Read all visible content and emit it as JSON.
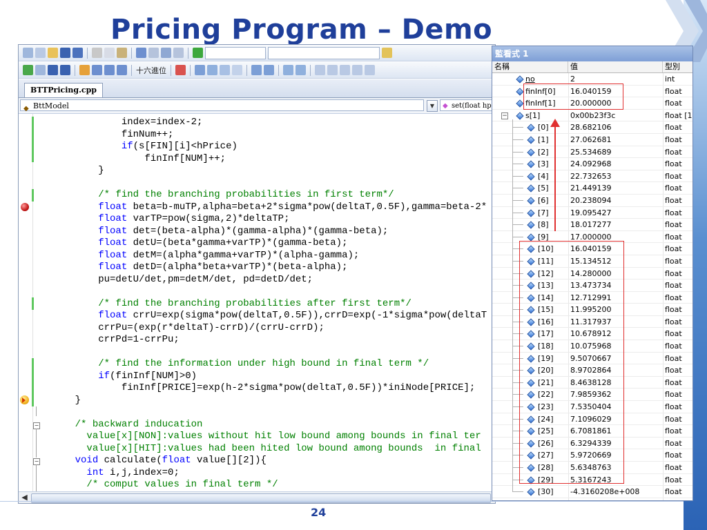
{
  "slide": {
    "title": "Pricing Program – Demo",
    "page_number": "24"
  },
  "ide": {
    "toolbar2_hex_label": "十六進位",
    "file_tab": "BTTPricing.cpp",
    "class_dropdown": "BttModel",
    "member_dropdown": "set(float hp",
    "code_lines": [
      {
        "indent": 12,
        "segments": [
          {
            "t": "index=index-2;",
            "c": ""
          }
        ]
      },
      {
        "indent": 12,
        "segments": [
          {
            "t": "finNum++;",
            "c": ""
          }
        ]
      },
      {
        "indent": 12,
        "segments": [
          {
            "t": "if",
            "c": "kw"
          },
          {
            "t": "(s[FIN][i]<hPrice)",
            "c": ""
          }
        ]
      },
      {
        "indent": 16,
        "segments": [
          {
            "t": "finInf[NUM]++;",
            "c": ""
          }
        ]
      },
      {
        "indent": 8,
        "segments": [
          {
            "t": "}",
            "c": ""
          }
        ]
      },
      {
        "indent": 0,
        "segments": []
      },
      {
        "indent": 8,
        "segments": [
          {
            "t": "/* find the branching probabilities in first term*/",
            "c": "cm"
          }
        ]
      },
      {
        "indent": 8,
        "segments": [
          {
            "t": "float",
            "c": "kw"
          },
          {
            "t": " beta=b-muTP,alpha=beta+2*sigma*pow(deltaT,0.5F),gamma=beta-2*",
            "c": ""
          }
        ]
      },
      {
        "indent": 8,
        "segments": [
          {
            "t": "float",
            "c": "kw"
          },
          {
            "t": " varTP=pow(sigma,2)*deltaTP;",
            "c": ""
          }
        ]
      },
      {
        "indent": 8,
        "segments": [
          {
            "t": "float",
            "c": "kw"
          },
          {
            "t": " det=(beta-alpha)*(gamma-alpha)*(gamma-beta);",
            "c": ""
          }
        ]
      },
      {
        "indent": 8,
        "segments": [
          {
            "t": "float",
            "c": "kw"
          },
          {
            "t": " detU=(beta*gamma+varTP)*(gamma-beta);",
            "c": ""
          }
        ]
      },
      {
        "indent": 8,
        "segments": [
          {
            "t": "float",
            "c": "kw"
          },
          {
            "t": " detM=(alpha*gamma+varTP)*(alpha-gamma);",
            "c": ""
          }
        ]
      },
      {
        "indent": 8,
        "segments": [
          {
            "t": "float",
            "c": "kw"
          },
          {
            "t": " detD=(alpha*beta+varTP)*(beta-alpha);",
            "c": ""
          }
        ]
      },
      {
        "indent": 8,
        "segments": [
          {
            "t": "pu=detU/det,pm=detM/det, pd=detD/det;",
            "c": ""
          }
        ]
      },
      {
        "indent": 0,
        "segments": []
      },
      {
        "indent": 8,
        "segments": [
          {
            "t": "/* find the branching probabilities after first term*/",
            "c": "cm"
          }
        ]
      },
      {
        "indent": 8,
        "segments": [
          {
            "t": "float",
            "c": "kw"
          },
          {
            "t": " crrU=exp(sigma*pow(deltaT,0.5F)),crrD=exp(-1*sigma*pow(deltaT",
            "c": ""
          }
        ]
      },
      {
        "indent": 8,
        "segments": [
          {
            "t": "crrPu=(exp(r*deltaT)-crrD)/(crrU-crrD);",
            "c": ""
          }
        ]
      },
      {
        "indent": 8,
        "segments": [
          {
            "t": "crrPd=1-crrPu;",
            "c": ""
          }
        ]
      },
      {
        "indent": 0,
        "segments": []
      },
      {
        "indent": 8,
        "segments": [
          {
            "t": "/* find the information under high bound in final term */",
            "c": "cm"
          }
        ]
      },
      {
        "indent": 8,
        "segments": [
          {
            "t": "if",
            "c": "kw"
          },
          {
            "t": "(finInf[NUM]>0)",
            "c": ""
          }
        ]
      },
      {
        "indent": 12,
        "segments": [
          {
            "t": "finInf[PRICE]=exp(h-2*sigma*pow(deltaT,0.5F))*iniNode[PRICE];",
            "c": ""
          }
        ]
      },
      {
        "indent": 4,
        "segments": [
          {
            "t": "}",
            "c": ""
          }
        ]
      },
      {
        "indent": 0,
        "segments": []
      },
      {
        "indent": 4,
        "segments": [
          {
            "t": "/* backward inducation",
            "c": "cm"
          }
        ]
      },
      {
        "indent": 6,
        "segments": [
          {
            "t": "value[x][NON]:values without hit low bound among bounds in final ter",
            "c": "cm"
          }
        ]
      },
      {
        "indent": 6,
        "segments": [
          {
            "t": "value[x][HIT]:values had been hited low bound among bounds  in final",
            "c": "cm"
          }
        ]
      },
      {
        "indent": 4,
        "segments": [
          {
            "t": "void",
            "c": "kw"
          },
          {
            "t": " calculate(",
            "c": ""
          },
          {
            "t": "float",
            "c": "kw"
          },
          {
            "t": " value[][2]){",
            "c": ""
          }
        ]
      },
      {
        "indent": 6,
        "segments": [
          {
            "t": "int",
            "c": "kw"
          },
          {
            "t": " i,j,index=0;",
            "c": ""
          }
        ]
      },
      {
        "indent": 6,
        "segments": [
          {
            "t": "/* comput values in final term */",
            "c": "cm"
          }
        ]
      }
    ]
  },
  "watch": {
    "title": "監看式 1",
    "columns": {
      "name": "名稱",
      "value": "值",
      "type": "型別"
    },
    "rows": [
      {
        "name": "no",
        "value": "2",
        "type": "int",
        "level": 0
      },
      {
        "name": "finInf[0]",
        "value": "16.040159",
        "type": "float",
        "level": 0
      },
      {
        "name": "finInf[1]",
        "value": "20.000000",
        "type": "float",
        "level": 0
      },
      {
        "name": "s[1]",
        "value": "0x00b23f3c",
        "type": "float [1",
        "level": 0,
        "expanded": true
      },
      {
        "name": "[0]",
        "value": "28.682106",
        "type": "float",
        "level": 1
      },
      {
        "name": "[1]",
        "value": "27.062681",
        "type": "float",
        "level": 1
      },
      {
        "name": "[2]",
        "value": "25.534689",
        "type": "float",
        "level": 1
      },
      {
        "name": "[3]",
        "value": "24.092968",
        "type": "float",
        "level": 1
      },
      {
        "name": "[4]",
        "value": "22.732653",
        "type": "float",
        "level": 1
      },
      {
        "name": "[5]",
        "value": "21.449139",
        "type": "float",
        "level": 1
      },
      {
        "name": "[6]",
        "value": "20.238094",
        "type": "float",
        "level": 1
      },
      {
        "name": "[7]",
        "value": "19.095427",
        "type": "float",
        "level": 1
      },
      {
        "name": "[8]",
        "value": "18.017277",
        "type": "float",
        "level": 1
      },
      {
        "name": "[9]",
        "value": "17.000000",
        "type": "float",
        "level": 1
      },
      {
        "name": "[10]",
        "value": "16.040159",
        "type": "float",
        "level": 1
      },
      {
        "name": "[11]",
        "value": "15.134512",
        "type": "float",
        "level": 1
      },
      {
        "name": "[12]",
        "value": "14.280000",
        "type": "float",
        "level": 1
      },
      {
        "name": "[13]",
        "value": "13.473734",
        "type": "float",
        "level": 1
      },
      {
        "name": "[14]",
        "value": "12.712991",
        "type": "float",
        "level": 1
      },
      {
        "name": "[15]",
        "value": "11.995200",
        "type": "float",
        "level": 1
      },
      {
        "name": "[16]",
        "value": "11.317937",
        "type": "float",
        "level": 1
      },
      {
        "name": "[17]",
        "value": "10.678912",
        "type": "float",
        "level": 1
      },
      {
        "name": "[18]",
        "value": "10.075968",
        "type": "float",
        "level": 1
      },
      {
        "name": "[19]",
        "value": "9.5070667",
        "type": "float",
        "level": 1
      },
      {
        "name": "[20]",
        "value": "8.9702864",
        "type": "float",
        "level": 1
      },
      {
        "name": "[21]",
        "value": "8.4638128",
        "type": "float",
        "level": 1
      },
      {
        "name": "[22]",
        "value": "7.9859362",
        "type": "float",
        "level": 1
      },
      {
        "name": "[23]",
        "value": "7.5350404",
        "type": "float",
        "level": 1
      },
      {
        "name": "[24]",
        "value": "7.1096029",
        "type": "float",
        "level": 1
      },
      {
        "name": "[25]",
        "value": "6.7081861",
        "type": "float",
        "level": 1
      },
      {
        "name": "[26]",
        "value": "6.3294339",
        "type": "float",
        "level": 1
      },
      {
        "name": "[27]",
        "value": "5.9720669",
        "type": "float",
        "level": 1
      },
      {
        "name": "[28]",
        "value": "5.6348763",
        "type": "float",
        "level": 1
      },
      {
        "name": "[29]",
        "value": "5.3167243",
        "type": "float",
        "level": 1
      },
      {
        "name": "[30]",
        "value": "-4.3160208e+008",
        "type": "float",
        "level": 1
      }
    ]
  },
  "colors": {
    "title": "#1f3f9a",
    "keyword": "#0000ff",
    "comment": "#008000",
    "highlight_box": "#e03030"
  }
}
